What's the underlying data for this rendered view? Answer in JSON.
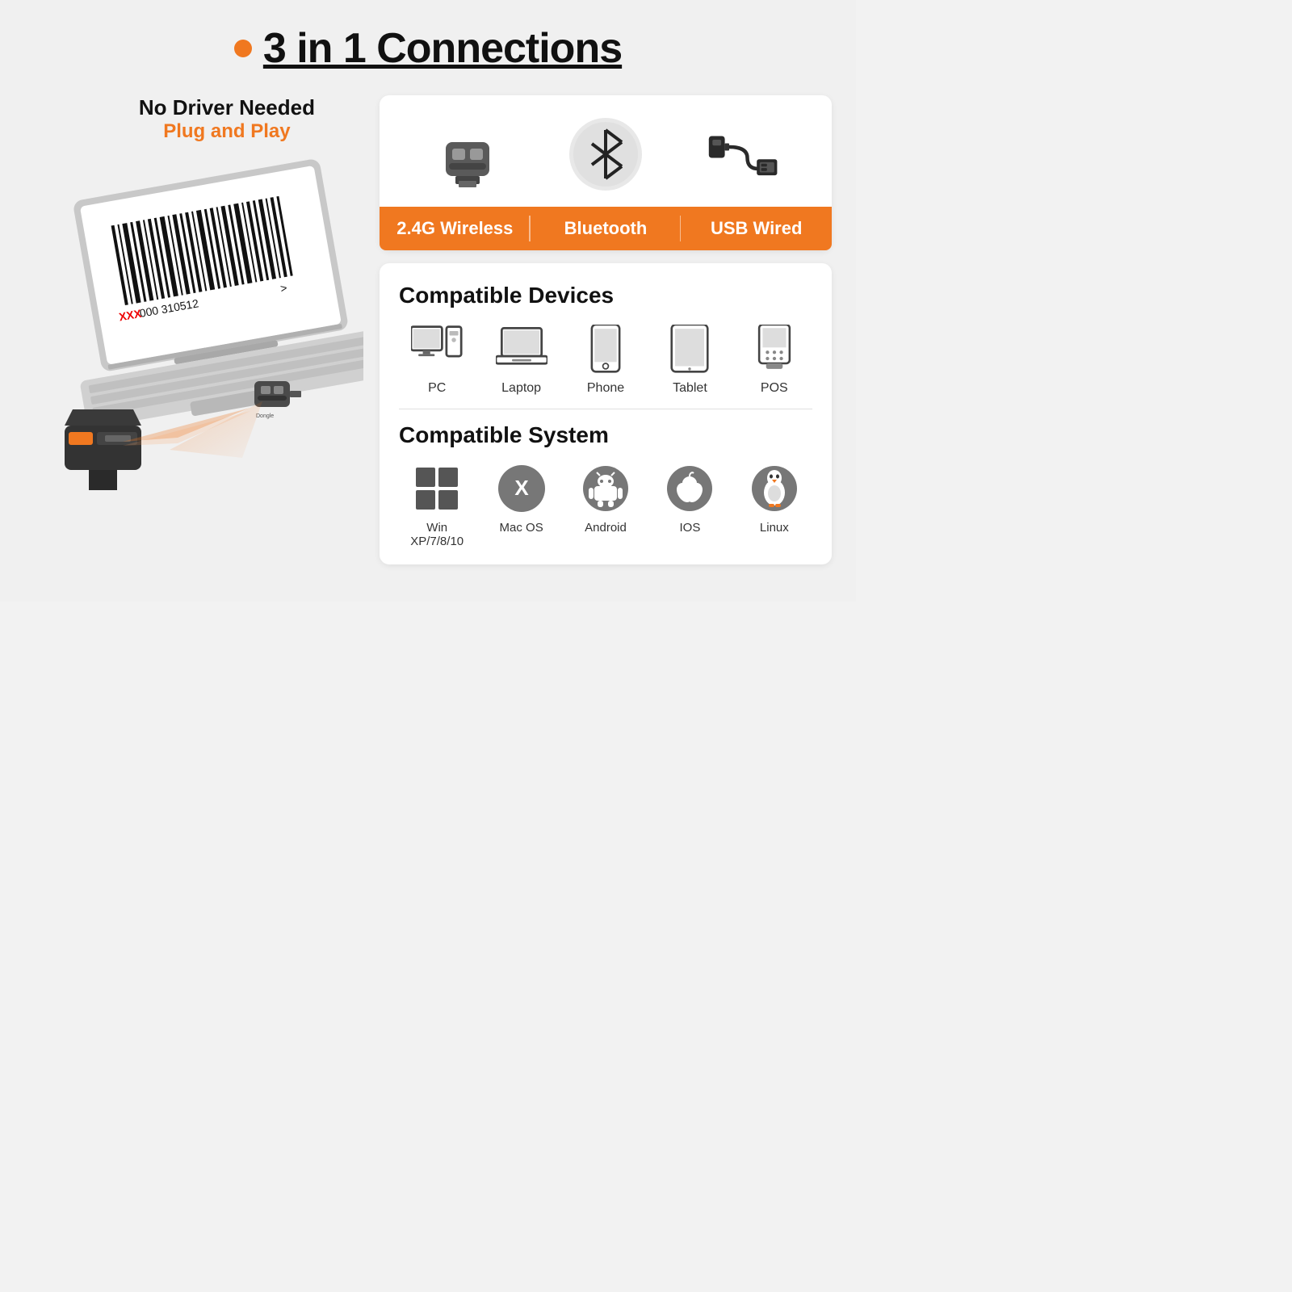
{
  "header": {
    "title": "3 in 1 Connections"
  },
  "left": {
    "no_driver_line1": "No Driver Needed",
    "no_driver_line2": "Plug and Play"
  },
  "connections": {
    "label_wireless": "2.4G Wireless",
    "label_bluetooth": "Bluetooth",
    "label_usb": "USB Wired"
  },
  "compatible_devices": {
    "title": "Compatible Devices",
    "items": [
      {
        "label": "PC"
      },
      {
        "label": "Laptop"
      },
      {
        "label": "Phone"
      },
      {
        "label": "Tablet"
      },
      {
        "label": "POS"
      }
    ]
  },
  "compatible_system": {
    "title": "Compatible System",
    "items": [
      {
        "label": "Win XP/7/8/10"
      },
      {
        "label": "Mac OS"
      },
      {
        "label": "Android"
      },
      {
        "label": "IOS"
      },
      {
        "label": "Linux"
      }
    ]
  }
}
